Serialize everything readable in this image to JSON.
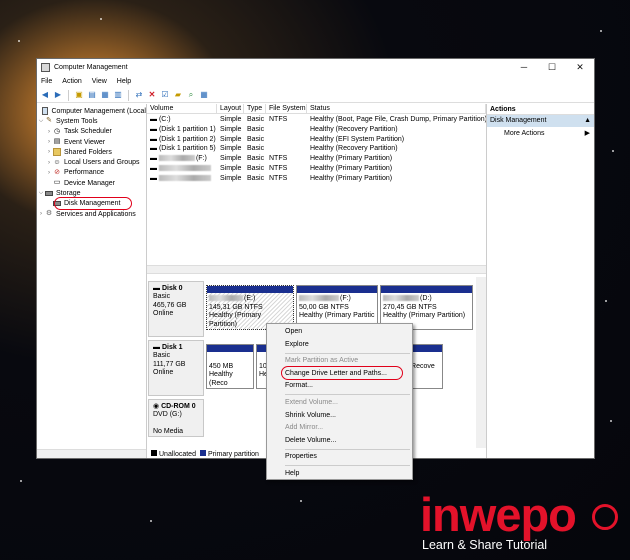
{
  "window": {
    "title": "Computer Management",
    "controls": {
      "minimize": "─",
      "maximize": "☐",
      "close": "✕"
    }
  },
  "menu": [
    "File",
    "Action",
    "View",
    "Help"
  ],
  "tree": {
    "root": "Computer Management (Local",
    "system_tools": "System Tools",
    "task_scheduler": "Task Scheduler",
    "event_viewer": "Event Viewer",
    "shared_folders": "Shared Folders",
    "local_users": "Local Users and Groups",
    "performance": "Performance",
    "device_manager": "Device Manager",
    "storage": "Storage",
    "disk_management": "Disk Management",
    "services": "Services and Applications"
  },
  "volumes": {
    "headers": [
      "Volume",
      "Layout",
      "Type",
      "File System",
      "Status"
    ],
    "rows": [
      {
        "name": "(C:)",
        "layout": "Simple",
        "type": "Basic",
        "fs": "NTFS",
        "status": "Healthy (Boot, Page File, Crash Dump, Primary Partition)"
      },
      {
        "name": "(Disk 1 partition 1)",
        "layout": "Simple",
        "type": "Basic",
        "fs": "",
        "status": "Healthy (Recovery Partition)"
      },
      {
        "name": "(Disk 1 partition 2)",
        "layout": "Simple",
        "type": "Basic",
        "fs": "",
        "status": "Healthy (EFI System Partition)"
      },
      {
        "name": "(Disk 1 partition 5)",
        "layout": "Simple",
        "type": "Basic",
        "fs": "",
        "status": "Healthy (Recovery Partition)"
      },
      {
        "name": "(F:)",
        "layout": "Simple",
        "type": "Basic",
        "fs": "NTFS",
        "status": "Healthy (Primary Partition)"
      },
      {
        "name": "",
        "layout": "Simple",
        "type": "Basic",
        "fs": "NTFS",
        "status": "Healthy (Primary Partition)"
      },
      {
        "name": "",
        "layout": "Simple",
        "type": "Basic",
        "fs": "NTFS",
        "status": "Healthy (Primary Partition)"
      }
    ]
  },
  "disks": {
    "disk0": {
      "name": "Disk 0",
      "type": "Basic",
      "size": "465,76 GB",
      "state": "Online",
      "partitions": [
        {
          "letter": "(E:)",
          "size": "145,31 GB NTFS",
          "status": "Healthy (Primary Partition)"
        },
        {
          "letter": "(F:)",
          "size": "50,00 GB NTFS",
          "status": "Healthy (Primary Partitic"
        },
        {
          "letter": "(D:)",
          "size": "270,45 GB NTFS",
          "status": "Healthy (Primary Partition)"
        }
      ]
    },
    "disk1": {
      "name": "Disk 1",
      "type": "Basic",
      "size": "111,77 GB",
      "state": "Online",
      "partitions": [
        {
          "size": "450 MB",
          "status": "Healthy (Reco"
        },
        {
          "size": "10",
          "status": "He"
        },
        {
          "size": "",
          "status": "Healthy (Recove"
        }
      ]
    },
    "cdrom": {
      "name": "CD-ROM 0",
      "type": "DVD (G:)",
      "media": "No Media"
    }
  },
  "legend": {
    "unallocated": "Unallocated",
    "primary": "Primary partition"
  },
  "actions": {
    "title": "Actions",
    "section": "Disk Management",
    "more": "More Actions"
  },
  "context_menu": {
    "open": "Open",
    "explore": "Explore",
    "mark_active": "Mark Partition as Active",
    "change_letter": "Change Drive Letter and Paths...",
    "format": "Format...",
    "extend": "Extend Volume...",
    "shrink": "Shrink Volume...",
    "add_mirror": "Add Mirror...",
    "delete": "Delete Volume...",
    "properties": "Properties",
    "help": "Help"
  },
  "watermark": {
    "brand": "inwepo",
    "tagline": "Learn & Share Tutorial"
  },
  "colors": {
    "primary_partition": "#1a2f8f",
    "highlight": "#e0001a",
    "brand": "#e3122a",
    "action_section": "#cfe0ef"
  }
}
